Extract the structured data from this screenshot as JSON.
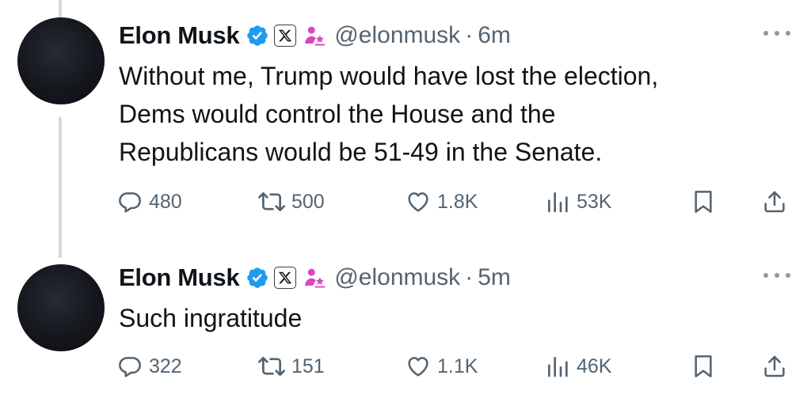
{
  "tweets": [
    {
      "author": {
        "name": "Elon Musk",
        "handle": "@elonmusk"
      },
      "separator": "·",
      "time": "6m",
      "text_lines": [
        "Without me, Trump would have lost the election,",
        "Dems would control the House and the",
        "Republicans would be 51-49 in the Senate."
      ],
      "stats": {
        "replies": "480",
        "reposts": "500",
        "likes": "1.8K",
        "views": "53K"
      }
    },
    {
      "author": {
        "name": "Elon Musk",
        "handle": "@elonmusk"
      },
      "separator": "·",
      "time": "5m",
      "text_lines": [
        "Such ingratitude"
      ],
      "stats": {
        "replies": "322",
        "reposts": "151",
        "likes": "1.1K",
        "views": "46K"
      }
    }
  ],
  "icons": {
    "verified": "verified-badge-icon",
    "affiliate": "x-affiliate-badge-icon",
    "role": "government-affiliation-icon",
    "reply": "reply-icon",
    "repost": "repost-icon",
    "like": "like-icon",
    "views": "views-icon",
    "bookmark": "bookmark-icon",
    "share": "share-icon",
    "more": "more-icon"
  },
  "colors": {
    "verified_blue": "#1d9bf0",
    "role_pink": "#d946c0",
    "secondary_text": "#536471",
    "thread_line": "#cfd9de"
  }
}
